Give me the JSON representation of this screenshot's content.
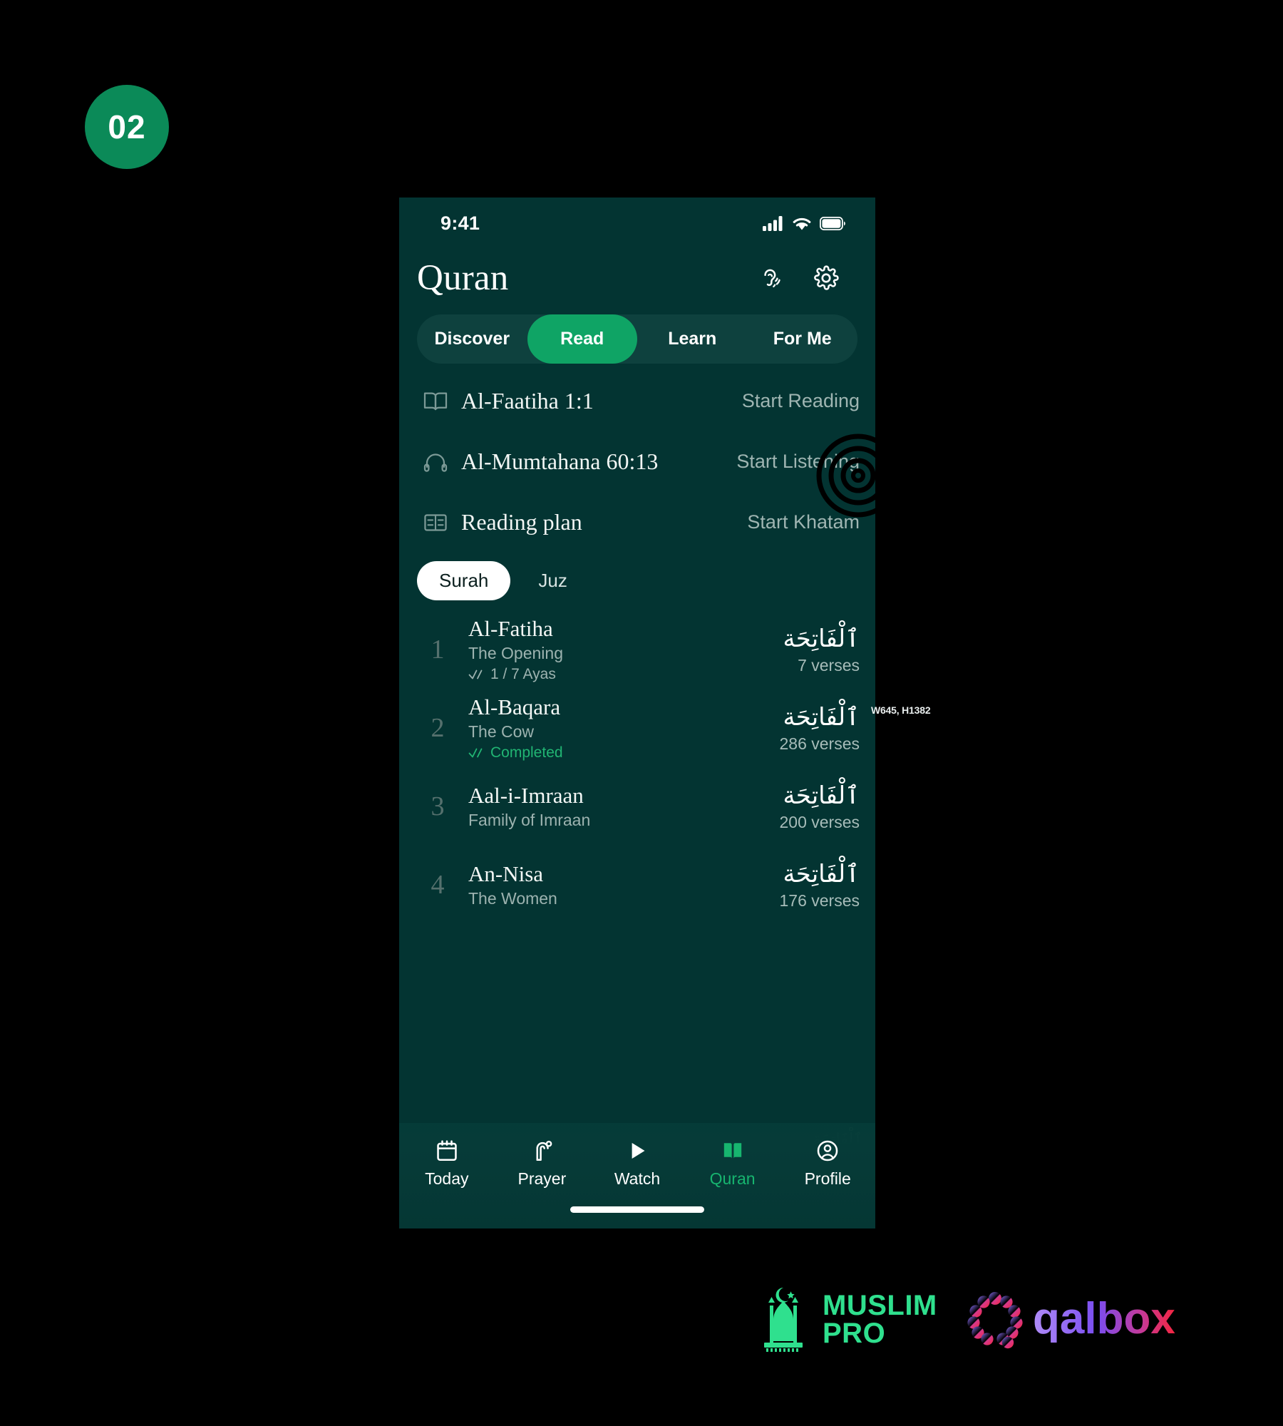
{
  "step_badge": {
    "label": "02"
  },
  "phone": {
    "status_bar": {
      "time": "9:41",
      "icons": [
        "cellular-signal-icon",
        "wifi-icon",
        "battery-icon"
      ]
    },
    "header": {
      "title": "Quran",
      "actions": [
        {
          "name": "listening-icon",
          "label": "Listening"
        },
        {
          "name": "settings-gear-icon",
          "label": "Settings"
        }
      ]
    },
    "segmented_tabs": {
      "items": [
        "Discover",
        "Read",
        "Learn",
        "For Me"
      ],
      "active": "Read",
      "active_color": "#0fa465",
      "track_color": "#0e413e"
    },
    "quick_actions": [
      {
        "icon": "open-book-icon",
        "label": "Al-Faatiha 1:1",
        "action": "Start Reading"
      },
      {
        "icon": "headphones-icon",
        "label": "Al-Mumtahana 60:13",
        "action": "Start Listening"
      },
      {
        "icon": "reading-plan-icon",
        "label": "Reading plan",
        "action": "Start Khatam"
      }
    ],
    "list_toggle": {
      "items": [
        "Surah",
        "Juz"
      ],
      "active": "Surah"
    },
    "surahs": [
      {
        "number": "1",
        "name": "Al-Fatiha",
        "meaning": "The Opening",
        "progress": "1 / 7 Ayas",
        "progress_state": "partial",
        "arabic": "ٱلْفَاتِحَة",
        "verses": "7 verses"
      },
      {
        "number": "2",
        "name": "Al-Baqara",
        "meaning": "The Cow",
        "progress": "Completed",
        "progress_state": "done",
        "arabic": "ٱلْفَاتِحَة",
        "verses": "286 verses"
      },
      {
        "number": "3",
        "name": "Aal-i-Imraan",
        "meaning": "Family of Imraan",
        "progress": "",
        "progress_state": "none",
        "arabic": "ٱلْفَاتِحَة",
        "verses": "200 verses"
      },
      {
        "number": "4",
        "name": "An-Nisa",
        "meaning": "The Women",
        "progress": "",
        "progress_state": "none",
        "arabic": "ٱلْفَاتِحَة",
        "verses": "176 verses"
      }
    ],
    "faint_arabic": "ٱلْفَاتِحَة",
    "bottom_nav": {
      "items": [
        {
          "icon": "calendar-icon",
          "label": "Today"
        },
        {
          "icon": "prayer-mat-icon",
          "label": "Prayer"
        },
        {
          "icon": "play-triangle-icon",
          "label": "Watch"
        },
        {
          "icon": "open-book-icon",
          "label": "Quran"
        },
        {
          "icon": "profile-avatar-icon",
          "label": "Profile"
        }
      ],
      "active": "Quran",
      "active_color": "#17b56f"
    }
  },
  "watermark": "W645, H1382",
  "footer": {
    "muslim_pro": {
      "line1": "MUSLIM",
      "line2": "PRO",
      "color": "#2fe08e"
    },
    "qalbox": {
      "label": "qalbox"
    }
  }
}
